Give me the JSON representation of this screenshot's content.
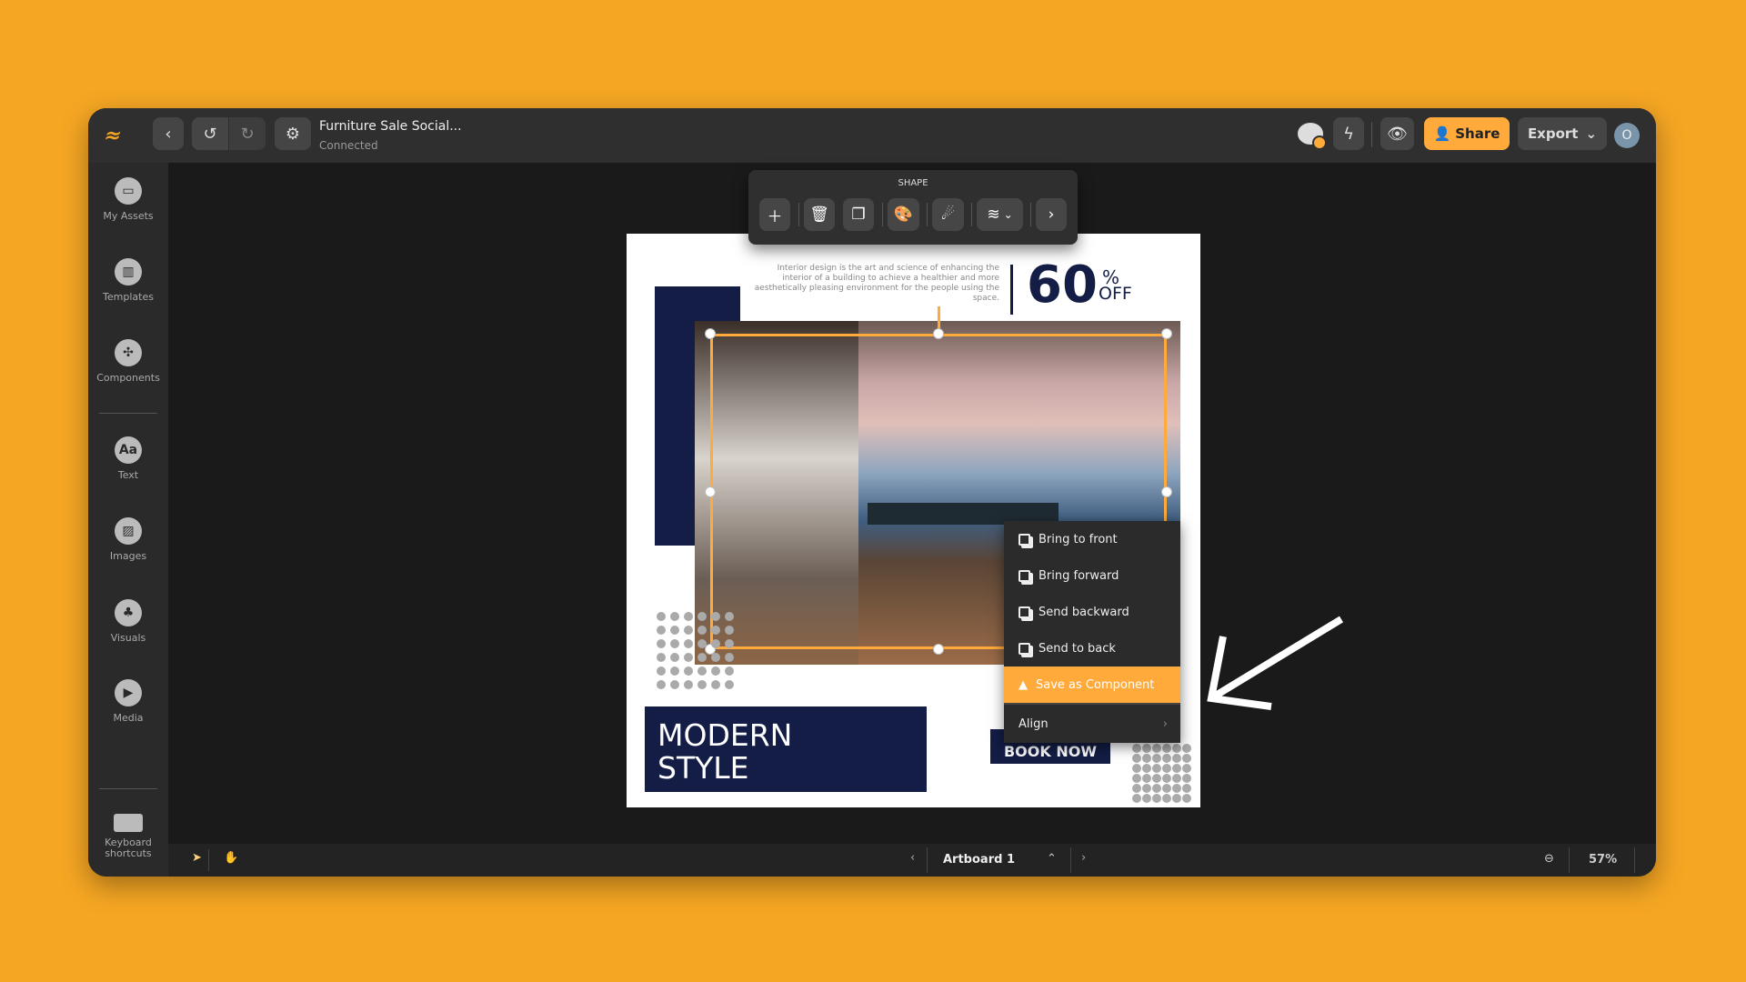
{
  "header": {
    "title": "Furniture Sale Social...",
    "status": "Connected",
    "share_label": "Share",
    "export_label": "Export",
    "avatar_initial": "O"
  },
  "sidebar": {
    "items": [
      {
        "label": "My Assets",
        "icon": "folder-icon"
      },
      {
        "label": "Templates",
        "icon": "templates-icon"
      },
      {
        "label": "Components",
        "icon": "components-icon"
      },
      {
        "label": "Text",
        "icon": "text-icon",
        "glyph": "Aa"
      },
      {
        "label": "Images",
        "icon": "image-icon"
      },
      {
        "label": "Visuals",
        "icon": "visuals-icon"
      },
      {
        "label": "Media",
        "icon": "play-icon"
      }
    ],
    "keyboard_label": "Keyboard shortcuts"
  },
  "toolbar": {
    "label": "SHAPE"
  },
  "artboard": {
    "paragraph": "Interior design is the art and science of enhancing the interior of a building to achieve a healthier and more aesthetically pleasing environment for the people using the space.",
    "discount": "60",
    "percent": "%",
    "off": "OFF",
    "headline_1": "MODERN",
    "headline_2": "STYLE",
    "cta": "BOOK NOW"
  },
  "context_menu": {
    "items": [
      "Bring to front",
      "Bring forward",
      "Send backward",
      "Send to back"
    ],
    "save_component": "Save as Component",
    "align": "Align"
  },
  "bottom": {
    "artboard_name": "Artboard 1",
    "zoom": "57%"
  },
  "colors": {
    "accent": "#ffaa3b",
    "navy": "#131d45",
    "background": "#f5a623"
  }
}
